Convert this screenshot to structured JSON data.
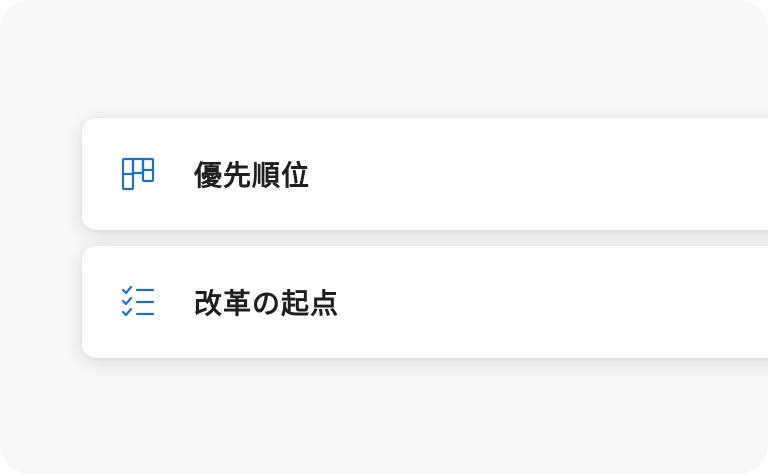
{
  "colors": {
    "panel_background": "#f6f6f6",
    "card_background": "#ffffff",
    "icon_accent": "#1a73c8",
    "label_text": "#1f1f1f"
  },
  "cards": [
    {
      "label": "優先順位",
      "icon": "board-layout-icon"
    },
    {
      "label": "改革の起点",
      "icon": "checklist-icon"
    }
  ]
}
